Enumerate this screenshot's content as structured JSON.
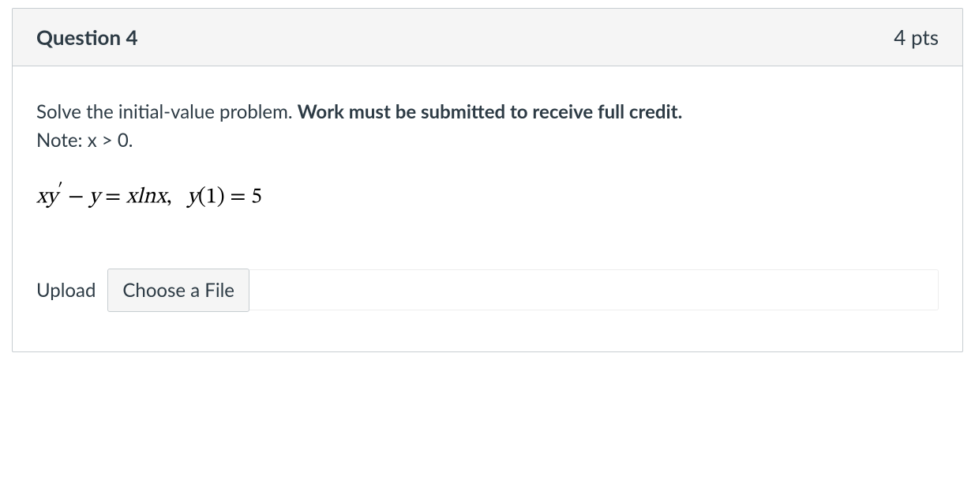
{
  "header": {
    "title": "Question 4",
    "points": "4 pts"
  },
  "body": {
    "p1_a": "Solve the initial-value problem.  ",
    "p1_b": "Work must be submitted to receive full credit.",
    "p2": "Note:  x > 0.",
    "eq_plain": "xy' − y = x ln x,   y(1) = 5"
  },
  "upload": {
    "label": "Upload",
    "button": "Choose a File"
  }
}
